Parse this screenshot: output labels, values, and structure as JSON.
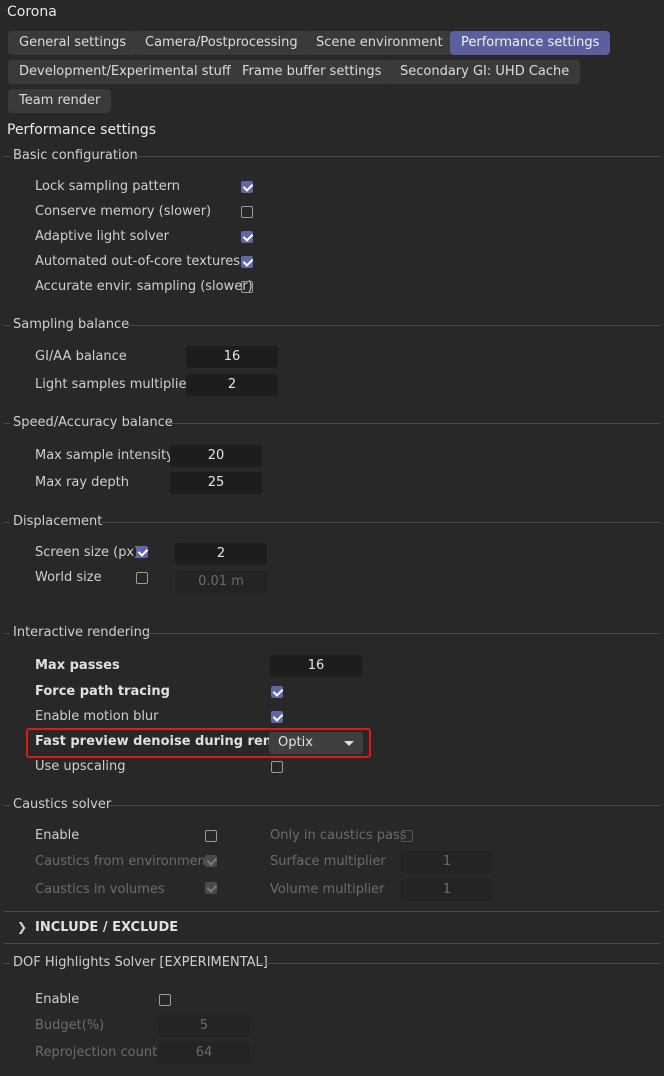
{
  "window_title": "Corona",
  "tabs": [
    "General settings",
    "Camera/Postprocessing",
    "Scene environment",
    "Performance settings",
    "Development/Experimental stuff",
    "Frame buffer settings",
    "Secondary GI: UHD Cache",
    "Team render"
  ],
  "active_tab": "Performance settings",
  "page_heading": "Performance settings",
  "basic": {
    "title": "Basic configuration",
    "items": [
      {
        "label": "Lock sampling pattern",
        "checked": true
      },
      {
        "label": "Conserve memory (slower)",
        "checked": false
      },
      {
        "label": "Adaptive light solver",
        "checked": true
      },
      {
        "label": "Automated out-of-core textures",
        "checked": true
      },
      {
        "label": "Accurate envir. sampling (slower)",
        "checked": false
      }
    ]
  },
  "sampling": {
    "title": "Sampling balance",
    "gi_aa_label": "GI/AA balance",
    "gi_aa_value": "16",
    "light_label": "Light samples multiplier",
    "light_value": "2"
  },
  "speed": {
    "title": "Speed/Accuracy balance",
    "intensity_label": "Max sample intensity",
    "intensity_value": "20",
    "depth_label": "Max ray depth",
    "depth_value": "25"
  },
  "displacement": {
    "title": "Displacement",
    "screen_label": "Screen size (px)",
    "screen_checked": true,
    "screen_value": "2",
    "world_label": "World size",
    "world_checked": false,
    "world_value": "0.01 m"
  },
  "interactive": {
    "title": "Interactive rendering",
    "max_passes_label": "Max passes",
    "max_passes_value": "16",
    "force_pt_label": "Force path tracing",
    "force_pt_checked": true,
    "motion_blur_label": "Enable motion blur",
    "motion_blur_checked": true,
    "denoise_label": "Fast preview denoise during render",
    "denoise_value": "Optix",
    "upscaling_label": "Use upscaling",
    "upscaling_checked": false
  },
  "caustics": {
    "title": "Caustics solver",
    "enable_label": "Enable",
    "enable_checked": false,
    "only_pass_label": "Only in caustics pass",
    "only_pass_checked": false,
    "env_label": "Caustics from environment",
    "env_checked": true,
    "surface_label": "Surface multiplier",
    "surface_value": "1",
    "volumes_label": "Caustics in volumes",
    "volumes_checked": true,
    "volume_label": "Volume multiplier",
    "volume_value": "1"
  },
  "include_exclude": "INCLUDE / EXCLUDE",
  "dof": {
    "title": "DOF Highlights Solver [EXPERIMENTAL]",
    "enable_label": "Enable",
    "enable_checked": false,
    "budget_label": "Budget(%)",
    "budget_value": "5",
    "reprojection_label": "Reprojection count",
    "reprojection_value": "64"
  },
  "colors": {
    "accent": "#5b5f9e",
    "highlight_border": "#e01818",
    "background": "#282828"
  }
}
